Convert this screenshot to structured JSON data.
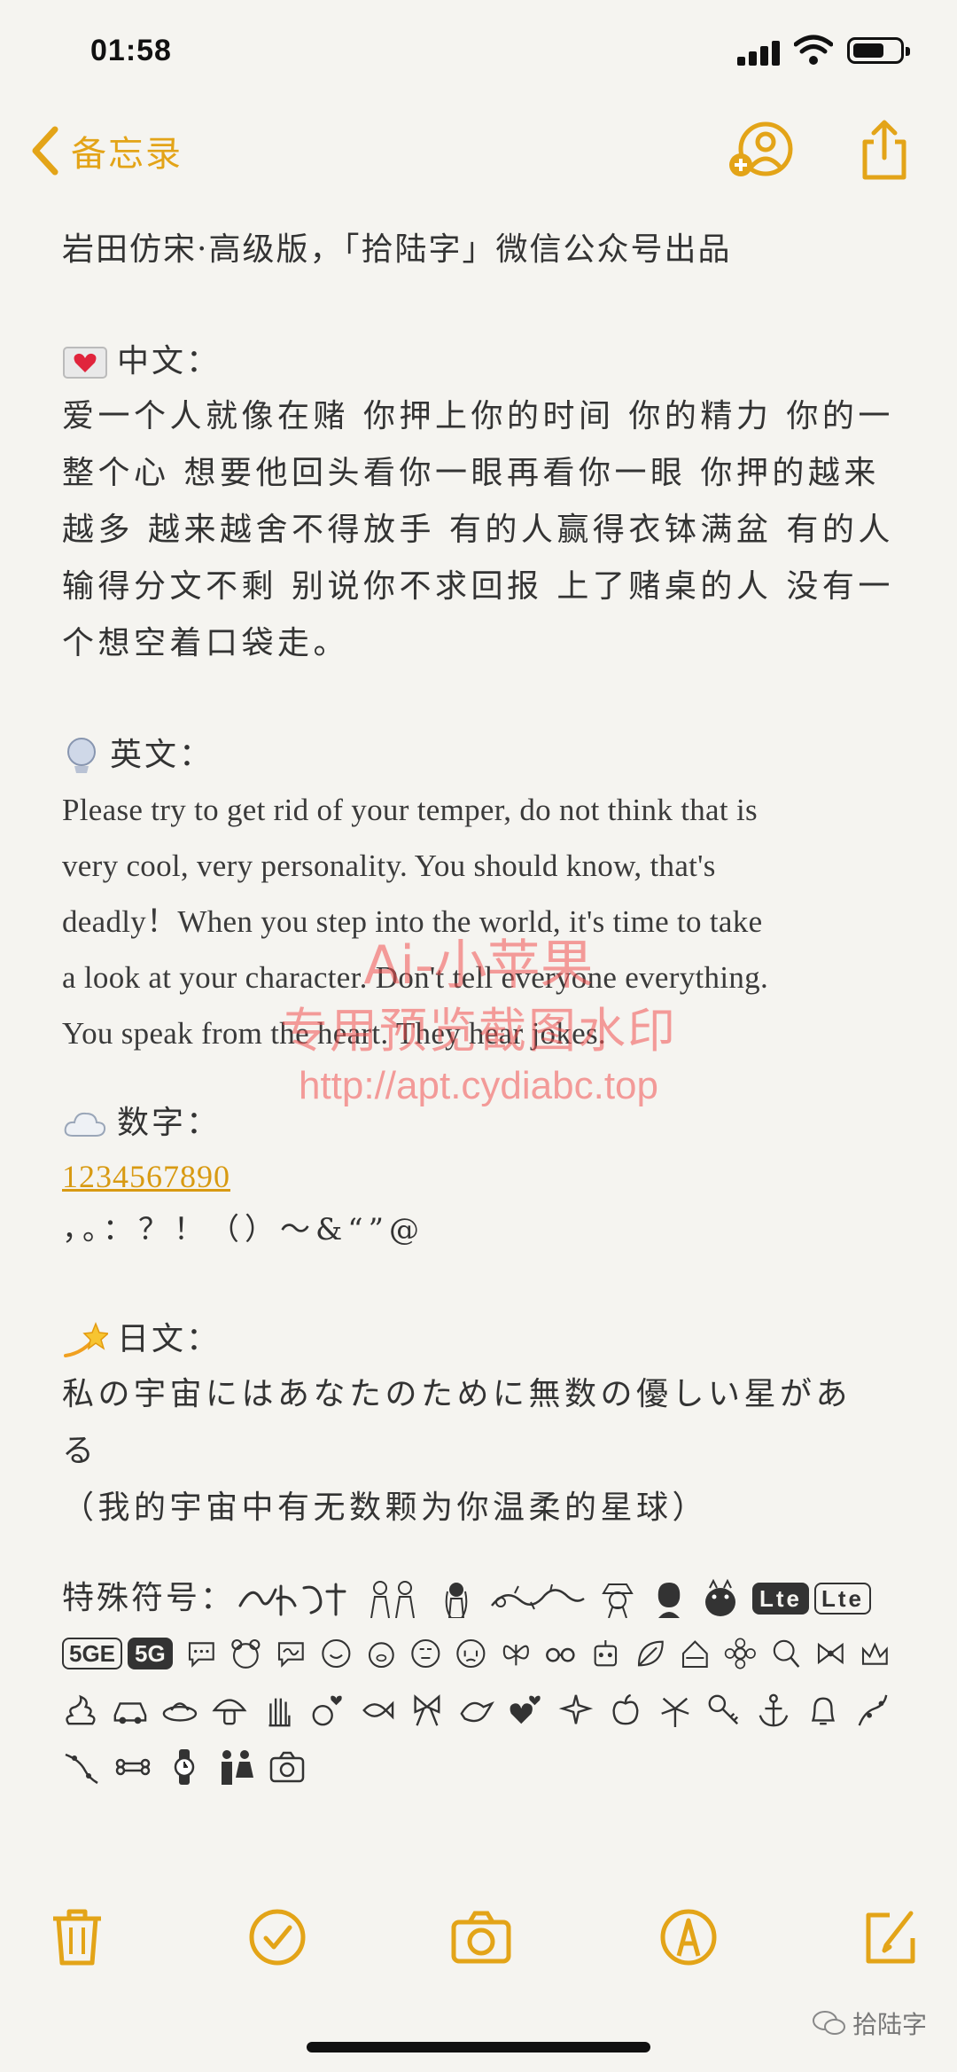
{
  "status": {
    "time": "01:58"
  },
  "nav": {
    "back_label": "备忘录"
  },
  "note": {
    "title": "岩田仿宋·高级版，「拾陆字」微信公众号出品",
    "chinese_heading": "中文：",
    "chinese_lines": [
      "爱一个人就像在赌 你押上你的时间 你的精力 你的一",
      "整个心 想要他回头看你一眼再看你一眼 你押的越来",
      "越多 越来越舍不得放手 有的人赢得衣钵满盆 有的人",
      "输得分文不剩 别说你不求回报 上了赌桌的人 没有一",
      "个想空着口袋走。"
    ],
    "english_heading": "英文：",
    "english_lines": [
      "Please try to get rid of your temper, do not think that is",
      "very cool, very personality. You should know, that's",
      "deadly！When you step into the world, it's time to take",
      "a look at your character. Don't tell everyone everything.",
      "You speak from the heart. They hear jokes."
    ],
    "digits_heading": "数字：",
    "digits": "1234567890",
    "punctuation": "，。：？！（）～&“”@",
    "japanese_heading": "日文：",
    "japanese_lines": [
      "私の宇宙にはあなたのために無数の優しい星があ",
      "る",
      "（我的宇宙中有无数颗为你温柔的星球）"
    ],
    "symbols_label": "特殊符号：",
    "lte_badges": [
      "Lte",
      "Lte"
    ],
    "fiveg_badges": [
      "5GE",
      "5G"
    ]
  },
  "watermark": {
    "line1": "Ai-小苹果",
    "line2": "专用预览截图水印",
    "line3": "http://apt.cydiabc.top"
  },
  "credit": "拾陆字",
  "colors": {
    "accent": "#e3a418",
    "background": "#f5f4f0",
    "text": "#333333",
    "watermark": "#f05050"
  },
  "icons": {
    "nav": [
      "chevron-left-icon",
      "add-person-icon",
      "share-icon"
    ],
    "toolbar": [
      "trash-icon",
      "checklist-icon",
      "camera-icon",
      "markup-icon",
      "compose-icon"
    ]
  }
}
